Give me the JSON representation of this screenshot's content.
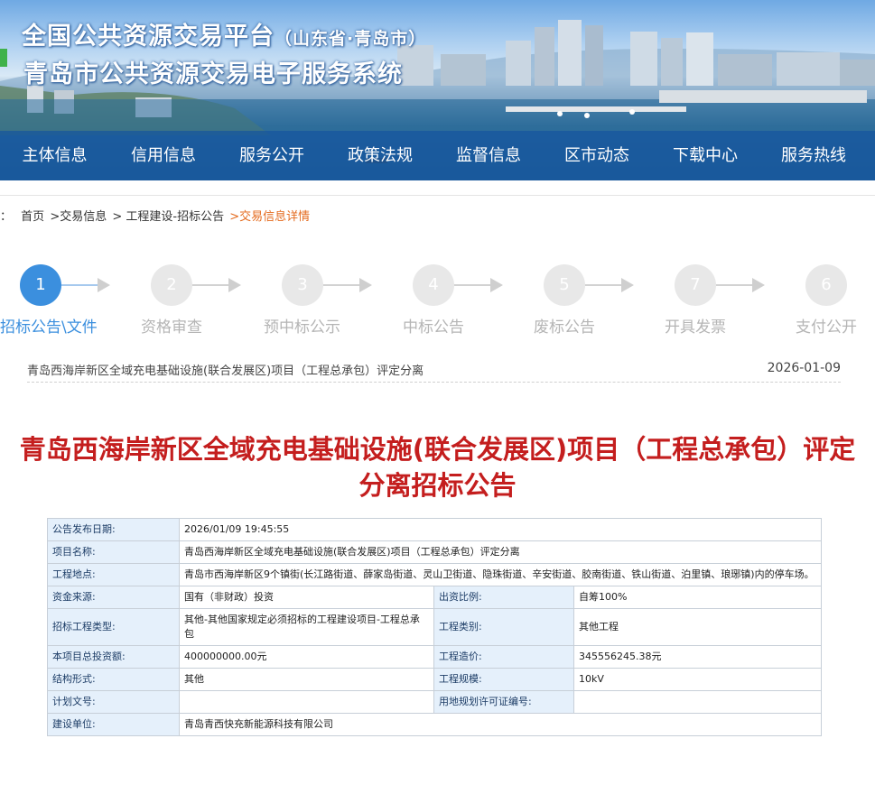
{
  "header": {
    "title_main": "全国公共资源交易平台",
    "title_region": "（山东省·青岛市）",
    "subtitle": "青岛市公共资源交易电子服务系统"
  },
  "nav": [
    {
      "label": "主体信息"
    },
    {
      "label": "信用信息"
    },
    {
      "label": "服务公开"
    },
    {
      "label": "政策法规"
    },
    {
      "label": "监督信息"
    },
    {
      "label": "区市动态"
    },
    {
      "label": "下载中心"
    },
    {
      "label": "服务热线"
    }
  ],
  "breadcrumb": {
    "prefix": "：",
    "items": [
      "首页",
      ">交易信息",
      "> 工程建设-招标公告",
      ">交易信息详情"
    ]
  },
  "steps": [
    {
      "num": "1",
      "label": "招标公告\\文件",
      "active": true
    },
    {
      "num": "2",
      "label": "资格审查",
      "active": false
    },
    {
      "num": "3",
      "label": "预中标公示",
      "active": false
    },
    {
      "num": "4",
      "label": "中标公告",
      "active": false
    },
    {
      "num": "5",
      "label": "废标公告",
      "active": false
    },
    {
      "num": "7",
      "label": "开具发票",
      "active": false
    },
    {
      "num": "6",
      "label": "支付公开",
      "active": false
    }
  ],
  "notice": {
    "list_title": "青岛西海岸新区全域充电基础设施(联合发展区)项目（工程总承包）评定分离",
    "date": "2026-01-09",
    "headline": "青岛西海岸新区全域充电基础设施(联合发展区)项目（工程总承包）评定分离招标公告"
  },
  "table": {
    "publish_date_label": "公告发布日期:",
    "publish_date": "2026/01/09 19:45:55",
    "project_name_label": "项目名称:",
    "project_name": "青岛西海岸新区全域充电基础设施(联合发展区)项目（工程总承包）评定分离",
    "location_label": "工程地点:",
    "location": "青岛市西海岸新区9个镇街(长江路街道、薛家岛街道、灵山卫街道、隐珠街道、辛安街道、胶南街道、铁山街道、泊里镇、琅琊镇)内的停车场。",
    "fund_source_label": "资金来源:",
    "fund_source": "国有（非财政）投资",
    "fund_ratio_label": "出资比例:",
    "fund_ratio": "自筹100%",
    "bid_type_label": "招标工程类型:",
    "bid_type": "其他-其他国家规定必须招标的工程建设项目-工程总承包",
    "category_label": "工程类别:",
    "category": "其他工程",
    "total_invest_label": "本项目总投资额:",
    "total_invest": "400000000.00元",
    "cost_label": "工程造价:",
    "cost": "345556245.38元",
    "structure_label": "结构形式:",
    "structure": "其他",
    "scale_label": "工程规模:",
    "scale": "10kV",
    "plan_doc_label": "计划文号:",
    "plan_doc": "",
    "land_permit_label": "用地规划许可证编号:",
    "land_permit": "",
    "builder_label": "建设单位:",
    "builder": "青岛青西快充新能源科技有限公司"
  }
}
